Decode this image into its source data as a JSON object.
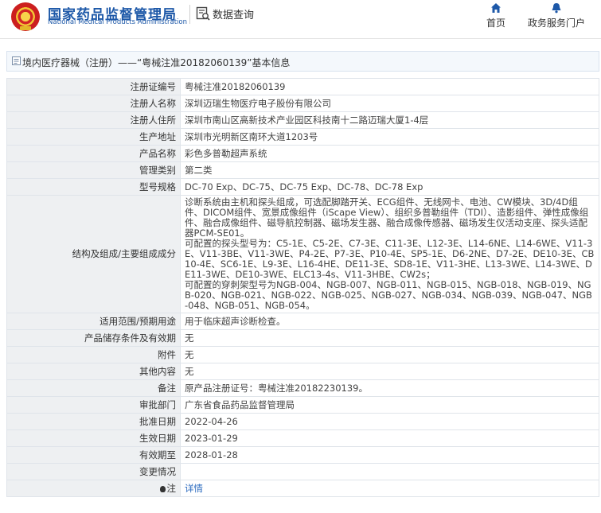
{
  "header": {
    "brand_cn": "国家药品监督管理局",
    "brand_en": "National Medical Products Administration",
    "query_label": "数据查询",
    "nav": [
      {
        "label": "首页",
        "icon": "home-icon"
      },
      {
        "label": "政务服务门户",
        "icon": "portal-icon"
      }
    ],
    "accent_color": "#1d58a8"
  },
  "breadcrumb": {
    "text": "境内医疗器械（注册）——“粤械注准20182060139”基本信息"
  },
  "rows": [
    {
      "label": "注册证编号",
      "value": "粤械注准20182060139"
    },
    {
      "label": "注册人名称",
      "value": "深圳迈瑞生物医疗电子股份有限公司"
    },
    {
      "label": "注册人住所",
      "value": "深圳市南山区高新技术产业园区科技南十二路迈瑞大厦1-4层"
    },
    {
      "label": "生产地址",
      "value": "深圳市光明新区南环大道1203号"
    },
    {
      "label": "产品名称",
      "value": "彩色多普勒超声系统"
    },
    {
      "label": "管理类别",
      "value": "第二类"
    },
    {
      "label": "型号规格",
      "value": "DC-70 Exp、DC-75、DC-75 Exp、DC-78、DC-78 Exp"
    },
    {
      "label": "结构及组成/主要组成成分",
      "value": "诊断系统由主机和探头组成，可选配脚踏开关、ECG组件、无线网卡、电池、CW模块、3D/4D组件、DICOM组件、宽景成像组件（iScape View）、组织多普勒组件（TDI）、造影组件、弹性成像组件、融合成像组件、磁导航控制器、磁场发生器、融合成像传感器、磁场发生仪活动支座、探头适配器PCM-SE01。\n可配置的探头型号为：C5-1E、C5-2E、C7-3E、C11-3E、L12-3E、L14-6NE、L14-6WE、V11-3E、V11-3BE、V11-3WE、P4-2E、P7-3E、P10-4E、SP5-1E、D6-2NE、D7-2E、DE10-3E、CB10-4E、SC6-1E、L9-3E、L16-4HE、DE11-3E、SD8-1E、V11-3HE、L13-3WE、L14-3WE、DE11-3WE、DE10-3WE、ELC13-4s、V11-3HBE、CW2s；\n可配置的穿刺架型号为NGB-004、NGB-007、NGB-011、NGB-015、NGB-018、NGB-019、NGB-020、NGB-021、NGB-022、NGB-025、NGB-027、NGB-034、NGB-039、NGB-047、NGB-048、NGB-051、NGB-054。"
    },
    {
      "label": "适用范围/预期用途",
      "value": "用于临床超声诊断检查。"
    },
    {
      "label": "产品储存条件及有效期",
      "value": "无"
    },
    {
      "label": "附件",
      "value": "无"
    },
    {
      "label": "其他内容",
      "value": "无"
    },
    {
      "label": "备注",
      "value": "原产品注册证号：粤械注准20182230139。"
    },
    {
      "label": "审批部门",
      "value": "广东省食品药品监督管理局"
    },
    {
      "label": "批准日期",
      "value": "2022-04-26"
    },
    {
      "label": "生效日期",
      "value": "2023-01-29"
    },
    {
      "label": "有效期至",
      "value": "2028-01-28"
    },
    {
      "label": "变更情况",
      "value": ""
    },
    {
      "label": "注",
      "value": "详情",
      "icon": "bulb-icon"
    }
  ]
}
